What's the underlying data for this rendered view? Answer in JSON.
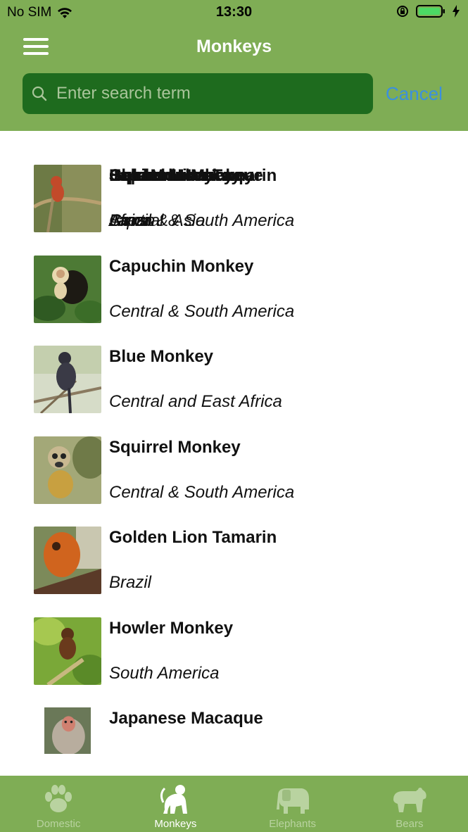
{
  "status": {
    "carrier": "No SIM",
    "time": "13:30"
  },
  "header": {
    "title": "Monkeys"
  },
  "search": {
    "placeholder": "Enter search term",
    "value": "",
    "cancel_label": "Cancel"
  },
  "list": {
    "overlapped_names": [
      "Baboon",
      "Blue Monkey",
      "Japanese Macaque",
      "Golden Lion Tamarin",
      "Howler Monkey",
      "Squirrel Monkey",
      "Capuchin Monkey"
    ],
    "overlapped_regions": [
      "Africa & Asia",
      "Japan",
      "Brazil",
      "Central & South America",
      "Africa",
      "Laos"
    ],
    "items": [
      {
        "name": "Capuchin Monkey",
        "region": "Central & South America"
      },
      {
        "name": "Blue Monkey",
        "region": "Central and East Africa"
      },
      {
        "name": "Squirrel Monkey",
        "region": "Central & South America"
      },
      {
        "name": "Golden Lion Tamarin",
        "region": "Brazil"
      },
      {
        "name": "Howler Monkey",
        "region": "South America"
      },
      {
        "name": "Japanese Macaque",
        "region": ""
      }
    ]
  },
  "tabs": [
    {
      "label": "Domestic",
      "icon": "paw-icon"
    },
    {
      "label": "Monkeys",
      "icon": "monkey-icon"
    },
    {
      "label": "Elephants",
      "icon": "elephant-icon"
    },
    {
      "label": "Bears",
      "icon": "bear-icon"
    }
  ],
  "colors": {
    "bar": "#7fad55",
    "search_field": "#1e6b1e",
    "cancel": "#3a8fe0"
  }
}
